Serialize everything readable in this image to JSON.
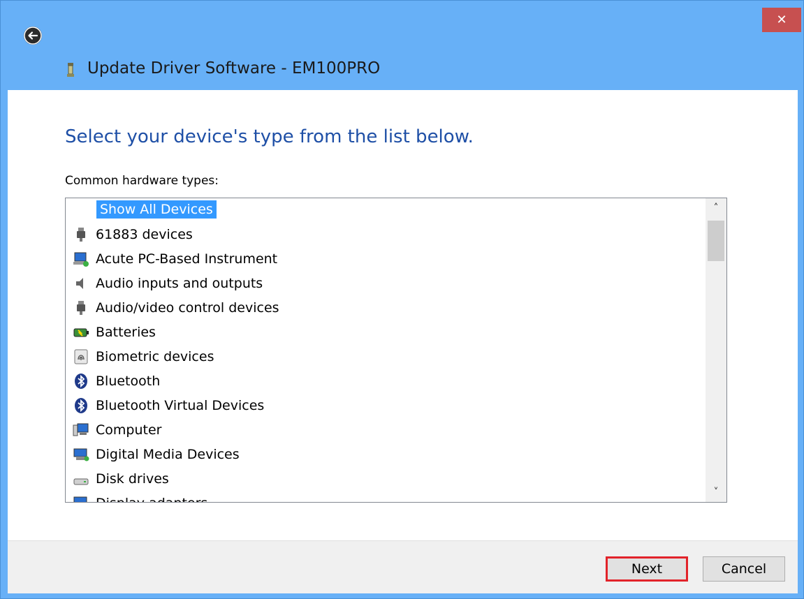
{
  "window": {
    "close_label": "✕",
    "title": "Update Driver Software - EM100PRO"
  },
  "main": {
    "heading": "Select your device's type from the list below.",
    "list_label": "Common hardware types:",
    "items": [
      {
        "label": "Show All Devices",
        "icon": "none",
        "selected": true
      },
      {
        "label": "61883 devices",
        "icon": "usb-plug-icon"
      },
      {
        "label": "Acute PC-Based Instrument",
        "icon": "network-pc-icon"
      },
      {
        "label": "Audio inputs and outputs",
        "icon": "speaker-icon"
      },
      {
        "label": "Audio/video control devices",
        "icon": "usb-plug-icon"
      },
      {
        "label": "Batteries",
        "icon": "battery-icon"
      },
      {
        "label": "Biometric devices",
        "icon": "fingerprint-icon"
      },
      {
        "label": "Bluetooth",
        "icon": "bluetooth-icon"
      },
      {
        "label": "Bluetooth Virtual Devices",
        "icon": "bluetooth-icon"
      },
      {
        "label": "Computer",
        "icon": "computer-icon"
      },
      {
        "label": "Digital Media Devices",
        "icon": "media-device-icon"
      },
      {
        "label": "Disk drives",
        "icon": "disk-drive-icon"
      },
      {
        "label": "Display adapters",
        "icon": "display-adapter-icon"
      }
    ],
    "scroll_up": "˄",
    "scroll_down": "˅"
  },
  "footer": {
    "next_label": "Next",
    "cancel_label": "Cancel"
  },
  "colors": {
    "titlebar": "#67b0f7",
    "heading": "#1e4fa6",
    "selection": "#3399ff",
    "highlight_border": "#e2232a"
  }
}
